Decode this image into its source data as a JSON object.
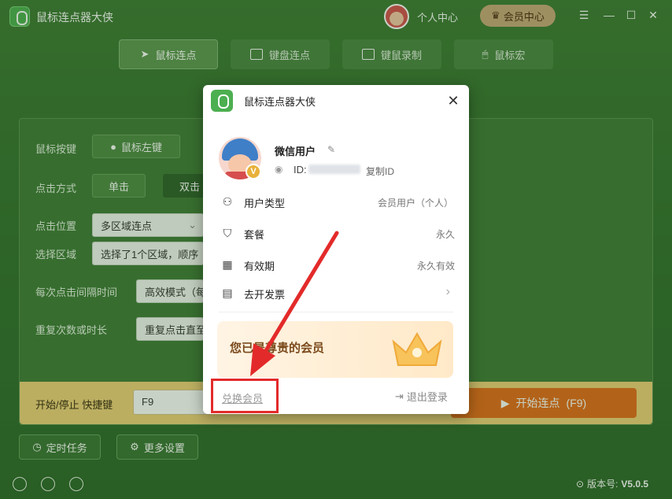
{
  "app": {
    "title": "鼠标连点器大侠"
  },
  "header": {
    "personal_center": "个人中心",
    "vip_center": "会员中心"
  },
  "tabs": [
    {
      "label": "鼠标连点",
      "active": true
    },
    {
      "label": "键盘连点",
      "active": false
    },
    {
      "label": "键鼠录制",
      "active": false
    },
    {
      "label": "鼠标宏",
      "active": false
    }
  ],
  "settings": {
    "mouse_button_label": "鼠标按键",
    "mouse_button_value": "鼠标左键",
    "click_mode_label": "点击方式",
    "click_single": "单击",
    "click_double": "双击",
    "click_position_label": "点击位置",
    "click_position_value": "多区域连点",
    "select_area_label": "选择区域",
    "select_area_value": "选择了1个区域，顺序",
    "interval_label": "每次点击间隔时间",
    "interval_value": "高效模式（每",
    "repeat_label": "重复次数或时长",
    "repeat_value": "重复点击直至"
  },
  "bottom": {
    "hotkey_label": "开始/停止 快捷键",
    "hotkey_value": "F9",
    "start_label": "开始连点",
    "start_hotkey": "(F9)"
  },
  "footer": {
    "scheduled": "定时任务",
    "more_settings": "更多设置",
    "version_label": "版本号:",
    "version_value": "V5.0.5"
  },
  "popup": {
    "title": "鼠标连点器大侠",
    "nickname": "微信用户",
    "id_label": "ID:",
    "copy_id": "复制ID",
    "rows": [
      {
        "label": "用户类型",
        "value": "会员用户（个人）",
        "icon": "user-icon"
      },
      {
        "label": "套餐",
        "value": "永久",
        "icon": "bag-icon"
      },
      {
        "label": "有效期",
        "value": "永久有效",
        "icon": "calendar-icon"
      },
      {
        "label": "去开发票",
        "value": "",
        "icon": "invoice-icon"
      }
    ],
    "vip_text": "您已是尊贵的会员",
    "redeem": "兑换会员",
    "logout": "退出登录"
  },
  "colors": {
    "accent_green": "#3d7a34",
    "highlight_red": "#e32a2a",
    "start_orange": "#e46c1a"
  }
}
